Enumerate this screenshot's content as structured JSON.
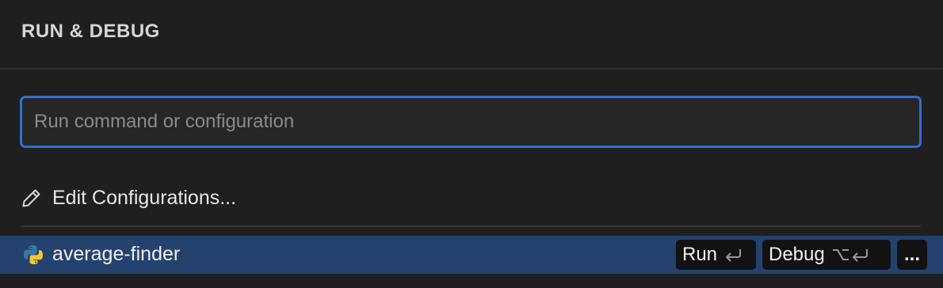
{
  "header": {
    "title": "RUN & DEBUG"
  },
  "search": {
    "placeholder": "Run command or configuration",
    "value": ""
  },
  "actions": {
    "edit_configurations_label": "Edit Configurations..."
  },
  "configurations": [
    {
      "name": "average-finder",
      "icon": "python-icon",
      "run_label": "Run",
      "run_shortcut": "↩",
      "debug_label": "Debug",
      "debug_shortcut": "⌥↩",
      "more_label": "..."
    }
  ],
  "colors": {
    "background": "#1f1f1f",
    "focus_border": "#2f6fd6",
    "selected_row": "#24426d",
    "python_blue": "#3b77a8",
    "python_yellow": "#f5c83a"
  }
}
